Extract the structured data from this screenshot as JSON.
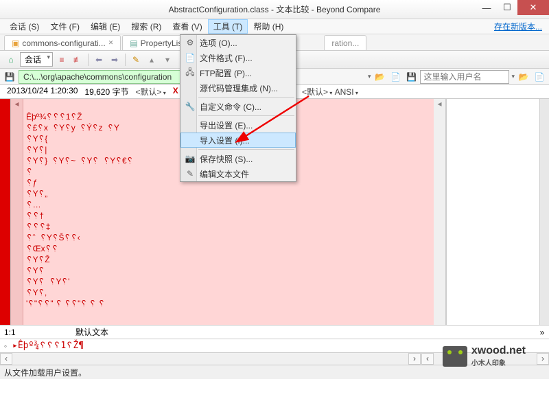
{
  "window": {
    "title": "AbstractConfiguration.class - 文本比较 - Beyond Compare",
    "new_version": "存在新版本..."
  },
  "menu": {
    "session": "会话 (S)",
    "file": "文件 (F)",
    "edit": "编辑 (E)",
    "search": "搜索 (R)",
    "view": "查看 (V)",
    "tools": "工具 (T)",
    "help": "帮助 (H)"
  },
  "tabs": {
    "t1": "commons-configurati...",
    "t2": "PropertyList-1...",
    "t3": "ration..."
  },
  "toolbar": {
    "sessionlbl": "会话"
  },
  "path": {
    "left": "C:\\...\\org\\apache\\commons\\configuration",
    "user_ph": "这里输入用户名"
  },
  "info": {
    "date": "2013/10/24 1:20:30",
    "size": "19,620 字节",
    "def": "<默认>",
    "ansi": "ANSI",
    "defr": "<默认>"
  },
  "dropdown": {
    "options": "选项 (O)...",
    "fileformat": "文件格式 (F)...",
    "ftp": "FTP配置 (P)...",
    "scm": "源代码管理集成 (N)...",
    "custom": "自定义命令 (C)...",
    "export": "导出设置 (E)...",
    "import": "导入设置 (I)...",
    "snapshot": "保存快照 (S)...",
    "edittext": "编辑文本文件"
  },
  "code": {
    "l1": "Êþº¾␦␦␦1␦Ž",
    "l2": "␦£␦x  ␦Y␦y  ␦Ý␦z  ␦Y",
    "l3": "␦Y␦{",
    "l4": "␦Y␦|",
    "l5": "␦Y␦}  ␦Y␦~  ␦Y␦  ␦Y␦€␦",
    "l6": "␦",
    "l7": "␦ƒ",
    "l8": "␦Y␦„",
    "l9": "␦…",
    "l10": "␦␦†",
    "l11": "␦␦␦‡",
    "l12": "␦ˆ  ␦Y␦Š␦␦‹",
    "l13": "␦Œx␦␦",
    "l14": "␦Y␦Ž",
    "l15": "␦Y␦",
    "l16": "␦Y␦  ␦Y␦'",
    "l17": "␦Y␦‚",
    "l18": "'␦\"␦␦\" ␦ ␦␦\"␦ ␦ ␦"
  },
  "status": {
    "pos": "1:1",
    "type": "默认文本",
    "bottom": "▸Êþº¾␦␦␦1␦Ž¶",
    "msg": "从文件加载用户设置。"
  },
  "watermark": {
    "domain": "xwood.net",
    "sub": "小木人印象"
  }
}
